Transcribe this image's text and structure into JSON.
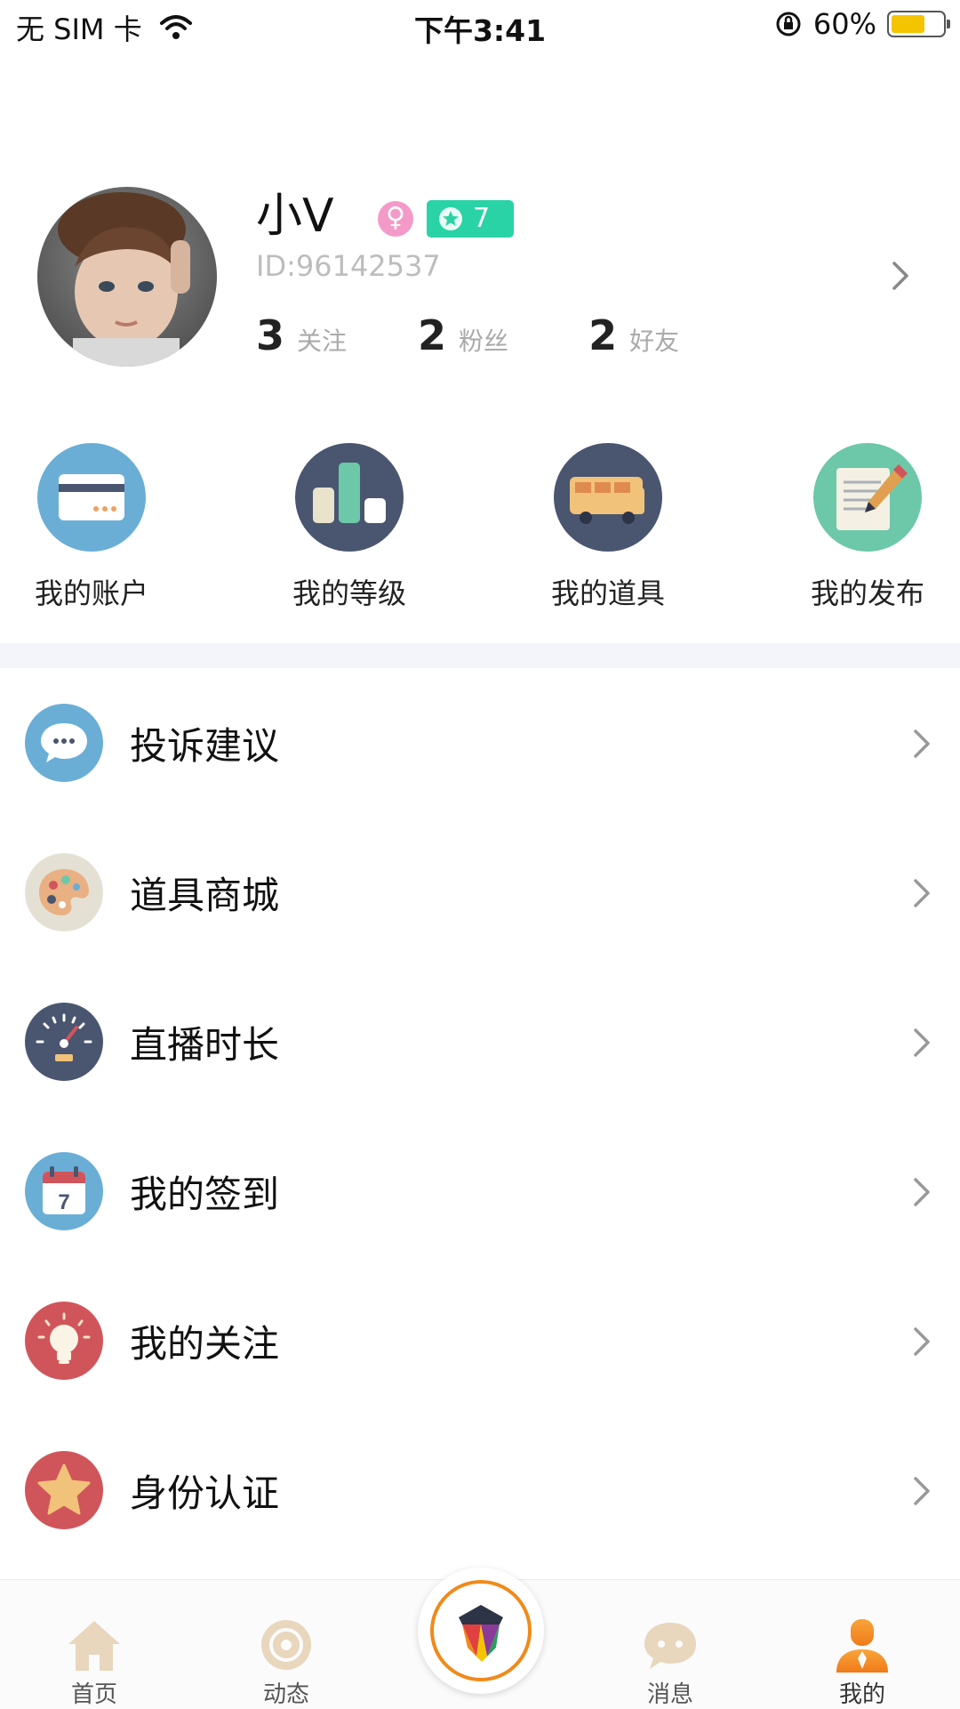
{
  "status_bar": {
    "carrier": "无 SIM 卡",
    "time": "下午3:41",
    "battery_percent": "60%",
    "battery_level": 0.6
  },
  "profile": {
    "name": "小V",
    "level": "7",
    "user_id": "ID:96142537",
    "stats": [
      {
        "count": "3",
        "label": "关注"
      },
      {
        "count": "2",
        "label": "粉丝"
      },
      {
        "count": "2",
        "label": "好友"
      }
    ]
  },
  "quick_actions": [
    {
      "label": "我的账户",
      "icon": "credit-card-icon",
      "color": "#6aaed6"
    },
    {
      "label": "我的等级",
      "icon": "bar-chart-icon",
      "color": "#4a5670"
    },
    {
      "label": "我的道具",
      "icon": "bus-icon",
      "color": "#4a5670"
    },
    {
      "label": "我的发布",
      "icon": "edit-document-icon",
      "color": "#6cc8a8"
    }
  ],
  "menu": [
    {
      "label": "投诉建议",
      "icon": "chat-bubble-icon",
      "color": "#6aaed6"
    },
    {
      "label": "道具商城",
      "icon": "palette-icon",
      "color": "#e4e1d4"
    },
    {
      "label": "直播时长",
      "icon": "speedometer-icon",
      "color": "#4a5670"
    },
    {
      "label": "我的签到",
      "icon": "calendar-icon",
      "color": "#6aaed6"
    },
    {
      "label": "我的关注",
      "icon": "lightbulb-icon",
      "color": "#d0555a"
    },
    {
      "label": "身份认证",
      "icon": "star-icon",
      "color": "#d0555a"
    }
  ],
  "tabbar": {
    "tabs": [
      {
        "label": "首页",
        "icon": "home-icon"
      },
      {
        "label": "动态",
        "icon": "target-icon"
      },
      {
        "label": "消息",
        "icon": "message-icon"
      },
      {
        "label": "我的",
        "icon": "user-icon",
        "active": true
      }
    ],
    "center": {
      "icon": "app-logo-icon"
    }
  },
  "colors": {
    "accent_orange": "#f08a1a",
    "level_badge": "#2ad3a6",
    "gender_badge": "#f49ac8",
    "divider": "#f4f5fb"
  }
}
